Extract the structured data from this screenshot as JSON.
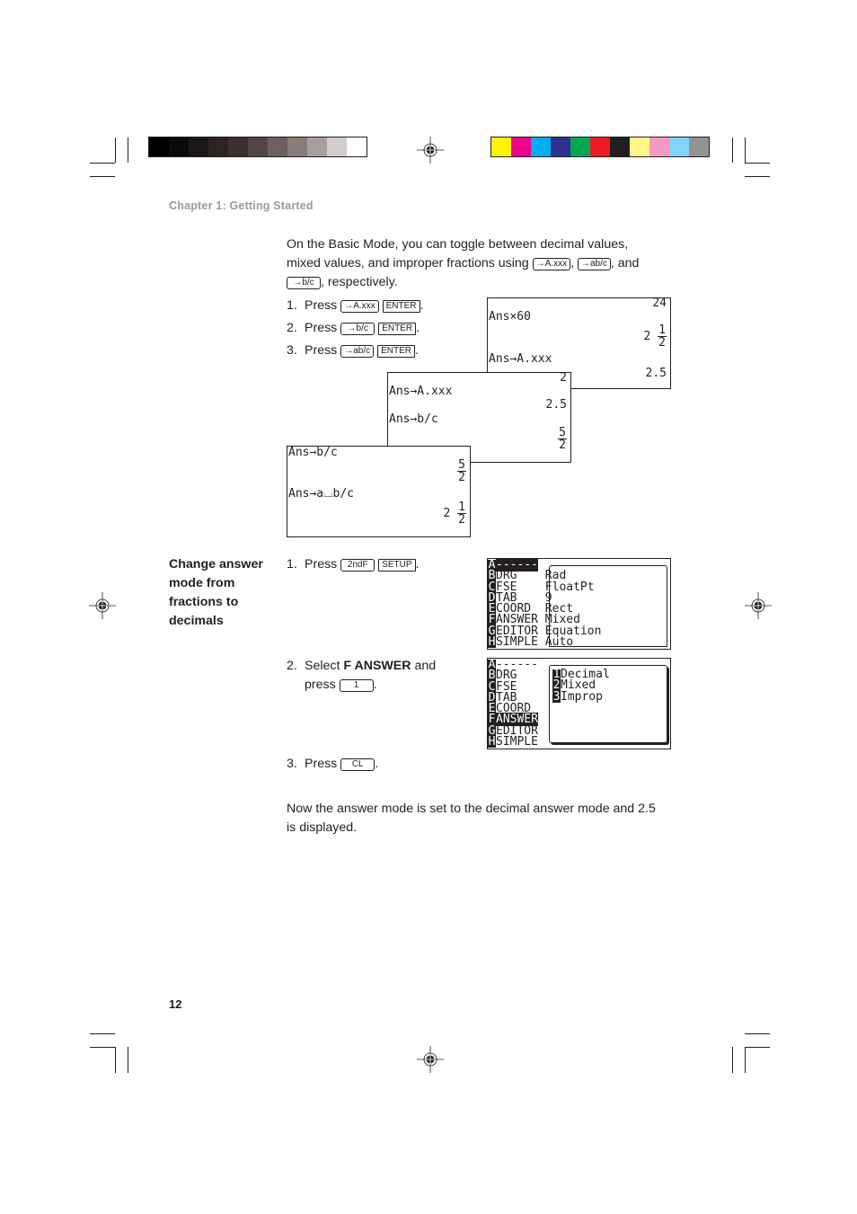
{
  "print_marks": {
    "gray_bar": [
      "#000000",
      "#0c0a09",
      "#1a1615",
      "#2a2322",
      "#3a302e",
      "#514846",
      "#6b605d",
      "#867c79",
      "#a8a09e",
      "#d3cccb",
      "#ffffff"
    ],
    "color_bar": [
      "#fff200",
      "#ec008c",
      "#00aeef",
      "#2e3192",
      "#00a651",
      "#ed1c24",
      "#231f20",
      "#fff685",
      "#f49ac2",
      "#7fd4f7",
      "#939393"
    ]
  },
  "header": {
    "chapter": "Chapter 1: Getting Started"
  },
  "intro": {
    "line1": "On the Basic Mode, you can toggle between decimal values,",
    "line2_pre": "mixed values, and improper fractions using ",
    "sep1": ", ",
    "sep2": ", and",
    "line3_post": ", respectively.",
    "keys": {
      "decimal": "→A.xxx",
      "mixed": "→ab/c",
      "improper": "→b/c"
    }
  },
  "steps_a": [
    {
      "num": "1.",
      "verb": "Press",
      "key1": "→A.xxx",
      "key2": "ENTER"
    },
    {
      "num": "2.",
      "verb": "Press",
      "key1": "→b/c",
      "key2": "ENTER"
    },
    {
      "num": "3.",
      "verb": "Press",
      "key1": "→ab/c",
      "key2": "ENTER"
    }
  ],
  "screen1": {
    "top_value": "24",
    "line1": "Ans×60",
    "result1_whole": "2",
    "result1_num": "1",
    "result1_den": "2",
    "line2": "Ans→A.xxx",
    "result2": "2.5"
  },
  "screen2": {
    "top_value": "2",
    "line1": "Ans→A.xxx",
    "result1": "2.5",
    "line2": "Ans→b/c",
    "result2_num": "5",
    "result2_den": "2"
  },
  "screen3": {
    "line1": "Ans→b/c",
    "result1_num": "5",
    "result1_den": "2",
    "line2": "Ans→a⌴b/c",
    "result2_whole": "2",
    "result2_num": "1",
    "result2_den": "2"
  },
  "section": {
    "title": "Change answer mode from fractions to decimals",
    "step1": {
      "num": "1.",
      "verb": "Press",
      "key1": "2ndF",
      "key2": "SETUP"
    },
    "step2": {
      "num": "2.",
      "pre": "Select ",
      "bold": "F ANSWER",
      "post": " and",
      "line2": "press",
      "key": "1"
    },
    "step3": {
      "num": "3.",
      "verb": "Press",
      "key": "CL"
    }
  },
  "setup_menu": {
    "items": [
      {
        "letter": "A",
        "label": "------",
        "value": ""
      },
      {
        "letter": "B",
        "label": "DRG",
        "value": "Rad"
      },
      {
        "letter": "C",
        "label": "FSE",
        "value": "FloatPt"
      },
      {
        "letter": "D",
        "label": "TAB",
        "value": "9"
      },
      {
        "letter": "E",
        "label": "COORD",
        "value": "Rect"
      },
      {
        "letter": "F",
        "label": "ANSWER",
        "value": "Mixed"
      },
      {
        "letter": "G",
        "label": "EDITOR",
        "value": "Equation"
      },
      {
        "letter": "H",
        "label": "SIMPLE",
        "value": "Auto"
      }
    ]
  },
  "answer_submenu": {
    "options": [
      {
        "num": "1",
        "label": "Decimal"
      },
      {
        "num": "2",
        "label": "Mixed"
      },
      {
        "num": "3",
        "label": "Improp"
      }
    ]
  },
  "conclusion": {
    "line1": "Now the answer mode is set to the decimal answer mode and 2.5",
    "line2": "is displayed."
  },
  "footer": {
    "page_number": "12"
  }
}
